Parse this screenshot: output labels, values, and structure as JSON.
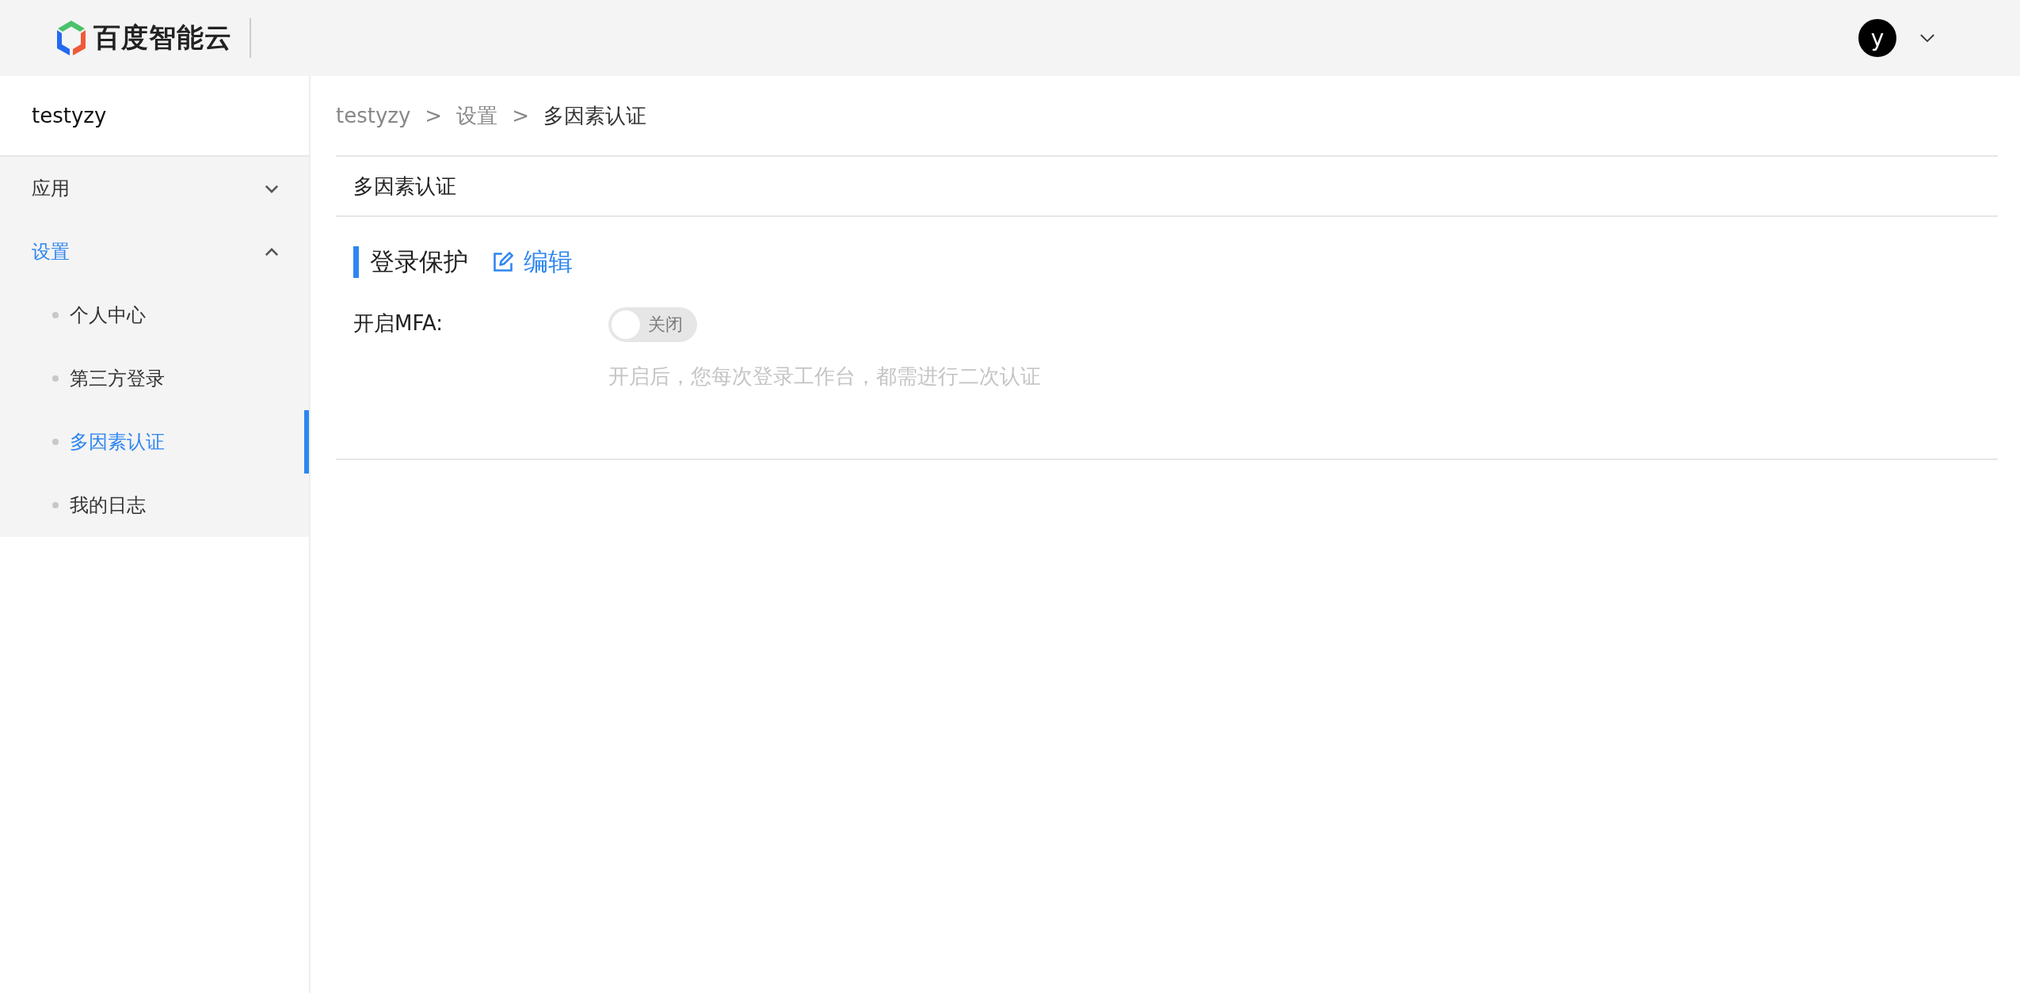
{
  "header": {
    "logo_text": "百度智能云",
    "avatar_letter": "y"
  },
  "sidebar": {
    "title": "testyzy",
    "items": [
      {
        "label": "应用",
        "expanded": false,
        "selected": false
      },
      {
        "label": "设置",
        "expanded": true,
        "selected": true,
        "children": [
          {
            "label": "个人中心",
            "selected": false
          },
          {
            "label": "第三方登录",
            "selected": false
          },
          {
            "label": "多因素认证",
            "selected": true
          },
          {
            "label": "我的日志",
            "selected": false
          }
        ]
      }
    ]
  },
  "breadcrumb": {
    "separator": ">",
    "items": [
      "testyzy",
      "设置",
      "多因素认证"
    ]
  },
  "card": {
    "title": "多因素认证",
    "section": {
      "title": "登录保护",
      "edit_label": "编辑"
    },
    "field": {
      "label": "开启MFA:",
      "toggle": {
        "on": false,
        "label": "关闭"
      },
      "help": "开启后，您每次登录工作台，都需进行二次认证"
    }
  }
}
